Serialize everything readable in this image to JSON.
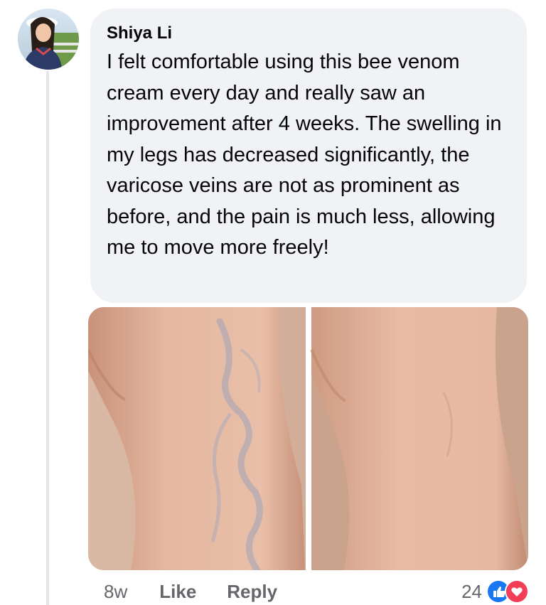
{
  "comment": {
    "author": "Shiya Li",
    "text": "I felt comfortable using this bee venom cream every day and really saw an improvement after 4 weeks. The swelling in my legs has decreased significantly, the varicose veins are not as prominent as before, and the pain is much less, allowing me to move more freely!",
    "time": "8w",
    "like_label": "Like",
    "reply_label": "Reply",
    "reaction_count": "24",
    "reactions": [
      "like-icon",
      "love-icon"
    ]
  },
  "colors": {
    "bubble": "#f0f2f5",
    "meta_text": "#65676b",
    "like_blue": "#1877f2",
    "love_red": "#f33e58"
  }
}
